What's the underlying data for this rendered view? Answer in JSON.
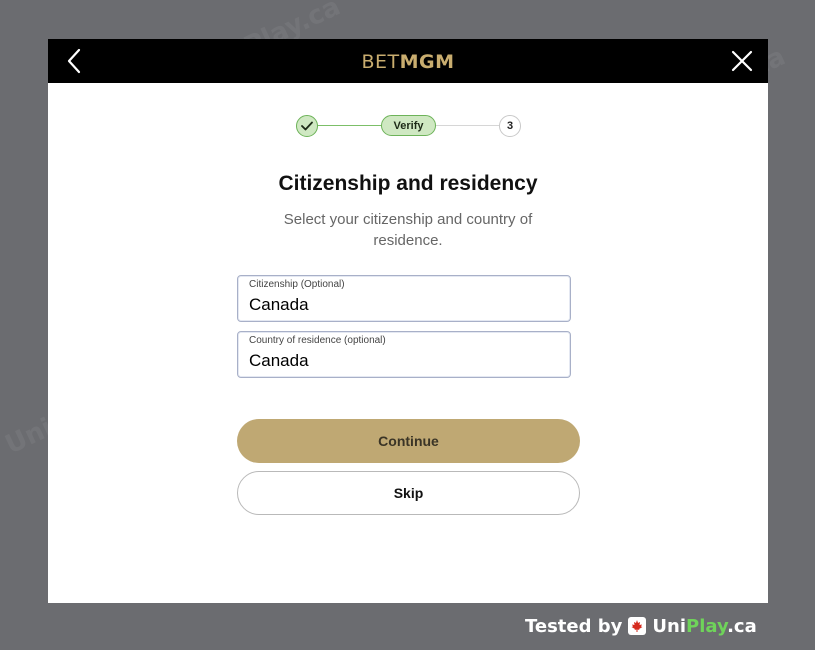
{
  "header": {
    "logo_bet": "BET",
    "logo_mgm": "MGM"
  },
  "stepper": {
    "step2_label": "Verify",
    "step3_label": "3"
  },
  "page": {
    "title": "Citizenship and residency",
    "subtitle": "Select your citizenship and country of residence."
  },
  "fields": {
    "citizenship_label": "Citizenship (Optional)",
    "citizenship_value": "Canada",
    "residence_label": "Country of residence (optional)",
    "residence_value": "Canada"
  },
  "buttons": {
    "continue_label": "Continue",
    "skip_label": "Skip"
  },
  "footer": {
    "tested_by": "Tested by",
    "brand_uni": "Uni",
    "brand_play": "Play",
    "brand_tld": ".ca"
  },
  "watermark_text": "UniPlay.ca",
  "colors": {
    "accent_gold": "#bfa873",
    "logo_gold": "#c9ad6f",
    "step_green": "#cfe8c2",
    "backdrop": "#6b6c70"
  }
}
